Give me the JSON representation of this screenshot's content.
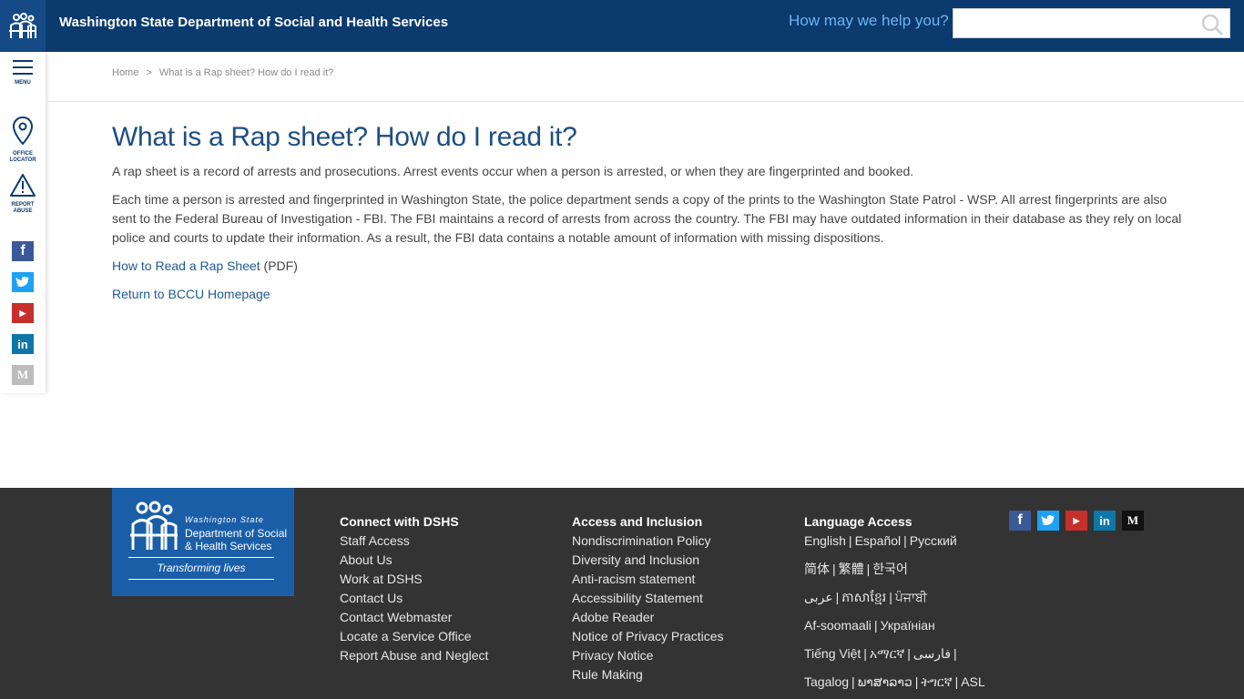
{
  "header": {
    "title": "Washington State Department of Social and Health Services",
    "help_text": "How may we help you?",
    "search_value": ""
  },
  "rail": {
    "menu_label": "MENU",
    "office_label_1": "OFFICE",
    "office_label_2": "LOCATOR",
    "report_label_1": "REPORT",
    "report_label_2": "ABUSE"
  },
  "breadcrumb": {
    "home": "Home",
    "separator": ">",
    "current": "What is a Rap sheet? How do I read it?"
  },
  "main": {
    "title": "What is a Rap sheet? How do I read it?",
    "para1": "A rap sheet is a record of arrests and prosecutions. Arrest events occur when a person is arrested, or when they are fingerprinted and booked.",
    "para2": "Each time a person is arrested and fingerprinted in Washington State, the police department sends a copy of the prints to the Washington State Patrol - WSP. All arrest fingerprints are also sent to the Federal Bureau of Investigation - FBI. The FBI maintains a record of arrests from across the country. The FBI may have outdated information in their database as they rely on local police and courts to update their information.  As a result, the FBI data contains a notable amount of information with missing dispositions.",
    "link1": "How to Read a Rap Sheet",
    "link1_suffix": " (PDF)",
    "link2": "Return to BCCU Homepage"
  },
  "footer": {
    "logo_small": "Washington State",
    "logo_line1": "Department of Social",
    "logo_line2": "& Health Services",
    "logo_tagline": "Transforming lives",
    "connect": {
      "heading": "Connect with DSHS",
      "links": [
        "Staff Access",
        "About Us",
        "Work at DSHS",
        "Contact Us",
        "Contact Webmaster",
        "Locate a Service Office",
        "Report Abuse and Neglect"
      ]
    },
    "access": {
      "heading": "Access and Inclusion",
      "links": [
        "Nondiscrimination Policy",
        "Diversity and Inclusion",
        "Anti-racism statement",
        "Accessibility Statement",
        "Adobe Reader",
        "Notice of Privacy Practices",
        "Privacy Notice",
        "Rule Making"
      ]
    },
    "language": {
      "heading": "Language Access",
      "lines": [
        [
          "English",
          "Español",
          "Русский"
        ],
        [
          "简体",
          "繁體",
          "한국어"
        ],
        [
          "عربى",
          "ភាសាខ្មែរ",
          "ਪੰਜਾਬੀ"
        ],
        [
          "Af-soomaali",
          "Українiан"
        ],
        [
          "Tiếng Việt",
          "አማርኛ",
          "فارسی"
        ],
        [
          "Tagalog",
          "ພາສາລາວ",
          "ትግርኛ",
          "ASL"
        ]
      ]
    }
  },
  "colors": {
    "header_bg": "#0b3a6e",
    "footer_bg": "#333333",
    "link": "#1e5a96",
    "facebook": "#3b5998",
    "twitter": "#1da1f2",
    "youtube": "#c4302b",
    "linkedin": "#0e76a8",
    "medium": "#111111"
  },
  "icons": [
    "dshs-logo-icon",
    "menu-icon",
    "location-pin-icon",
    "warning-icon",
    "facebook-icon",
    "twitter-icon",
    "youtube-icon",
    "linkedin-icon",
    "medium-icon",
    "search-icon"
  ]
}
